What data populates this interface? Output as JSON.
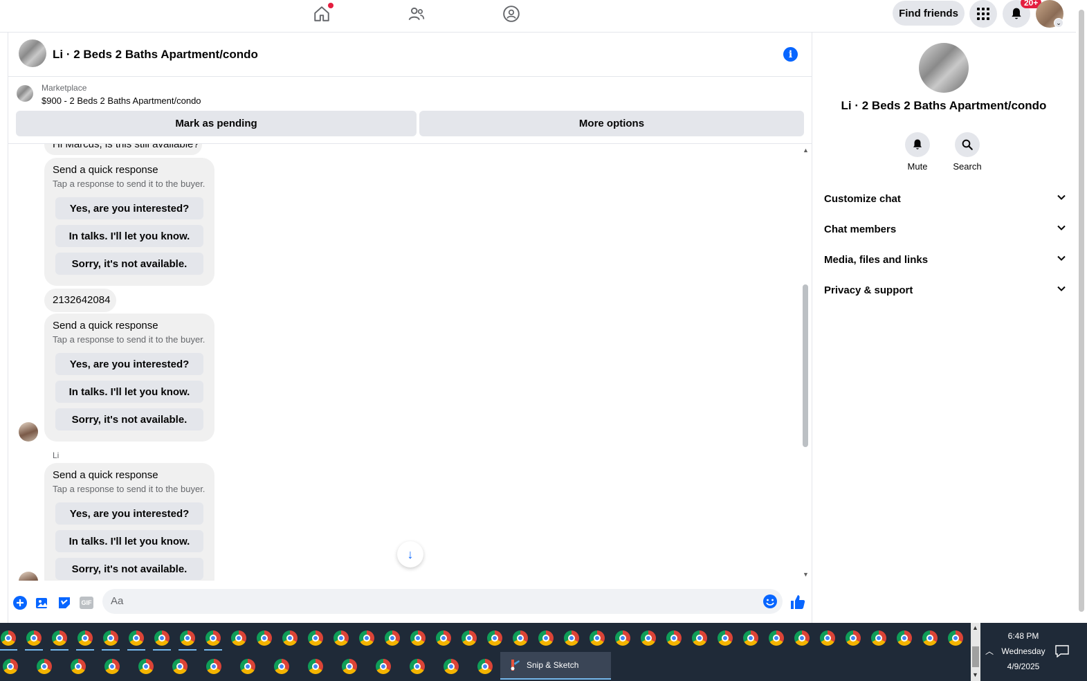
{
  "topnav": {
    "find_friends": "Find friends",
    "notification_count": "20+",
    "icons": [
      "home-icon",
      "friends-icon",
      "groups-icon",
      "menu-grid-icon",
      "bell-icon"
    ]
  },
  "chat": {
    "title": "Li · 2 Beds 2 Baths Apartment/condo",
    "marketplace_label": "Marketplace",
    "listing": "$900 - 2 Beds 2 Baths Apartment/condo",
    "mark_pending": "Mark as pending",
    "more_options": "More options",
    "partial_message": "Hi Marcus, is this still available?",
    "phone_message": "2132642084",
    "sender_name": "Li",
    "quick_response": {
      "title": "Send a quick response",
      "subtitle": "Tap a response to send it to the buyer.",
      "options": [
        "Yes, are you interested?",
        "In talks. I'll let you know.",
        "Sorry, it's not available."
      ]
    },
    "composer_placeholder": "Aa"
  },
  "right_panel": {
    "title": "Li · 2 Beds 2 Baths Apartment/condo",
    "mute": "Mute",
    "search": "Search",
    "sections": [
      "Customize chat",
      "Chat members",
      "Media, files and links",
      "Privacy & support"
    ]
  },
  "taskbar": {
    "snip_label": "Snip & Sketch",
    "time": "6:48 PM",
    "day": "Wednesday",
    "date": "4/9/2025"
  },
  "colors": {
    "accent": "#0866ff",
    "badge": "#e41e3f",
    "taskbar": "#1f2a38"
  }
}
